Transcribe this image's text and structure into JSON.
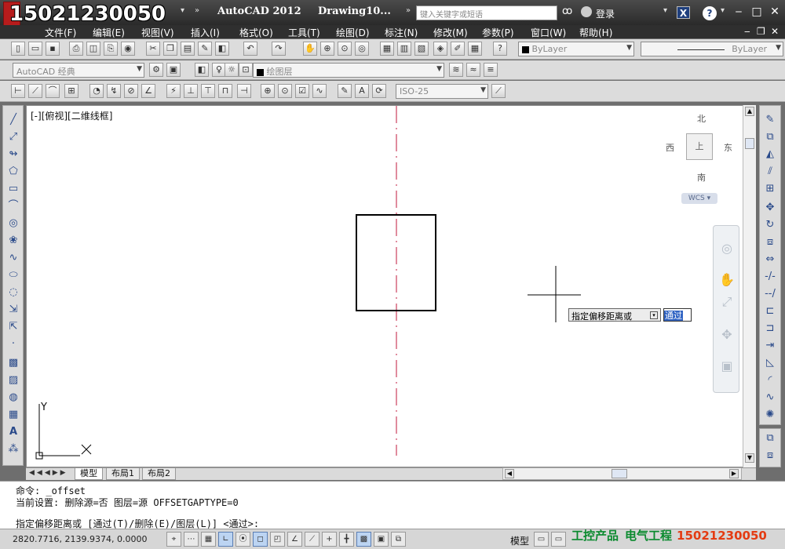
{
  "overlay": {
    "phone": "15021230050"
  },
  "titlebar": {
    "app_title": "AutoCAD 2012",
    "doc_title": "Drawing10...",
    "search_placeholder": "键入关键字或短语",
    "login_label": "登录"
  },
  "menu": {
    "items": [
      "文件(F)",
      "编辑(E)",
      "视图(V)",
      "插入(I)",
      "格式(O)",
      "工具(T)",
      "绘图(D)",
      "标注(N)",
      "修改(M)",
      "参数(P)",
      "窗口(W)",
      "帮助(H)"
    ]
  },
  "toolbar": {
    "workspace_combo": "AutoCAD 经典",
    "layer_combo": "绘图层",
    "color_combo": "ByLayer",
    "linetype_combo": "ByLayer",
    "dimstyle_combo": "ISO-25"
  },
  "canvas": {
    "viewport_label": "[-][俯视][二维线框]",
    "compass": {
      "north": "北",
      "south": "南",
      "east": "东",
      "west": "西",
      "center": "上"
    },
    "wcs_label": "WCS",
    "cmd_prompt": "指定偏移距离或",
    "input_value": "通过",
    "ucs": {
      "y_label": "Y",
      "x_label": "X"
    },
    "colors": {
      "centerline": "#c0183c"
    }
  },
  "layout_tabs": [
    "模型",
    "布局1",
    "布局2"
  ],
  "command": {
    "line1": "命令: _offset",
    "line2": "当前设置: 删除源=否  图层=源  OFFSETGAPTYPE=0",
    "line3": "指定偏移距离或 [通过(T)/删除(E)/图层(L)] <通过>:"
  },
  "status": {
    "coords": "2820.7716, 2139.9374, 0.0000",
    "model_label": "模型"
  },
  "banner": {
    "part1": "工控产品",
    "part2": "电气工程",
    "part3": "15021230050"
  }
}
